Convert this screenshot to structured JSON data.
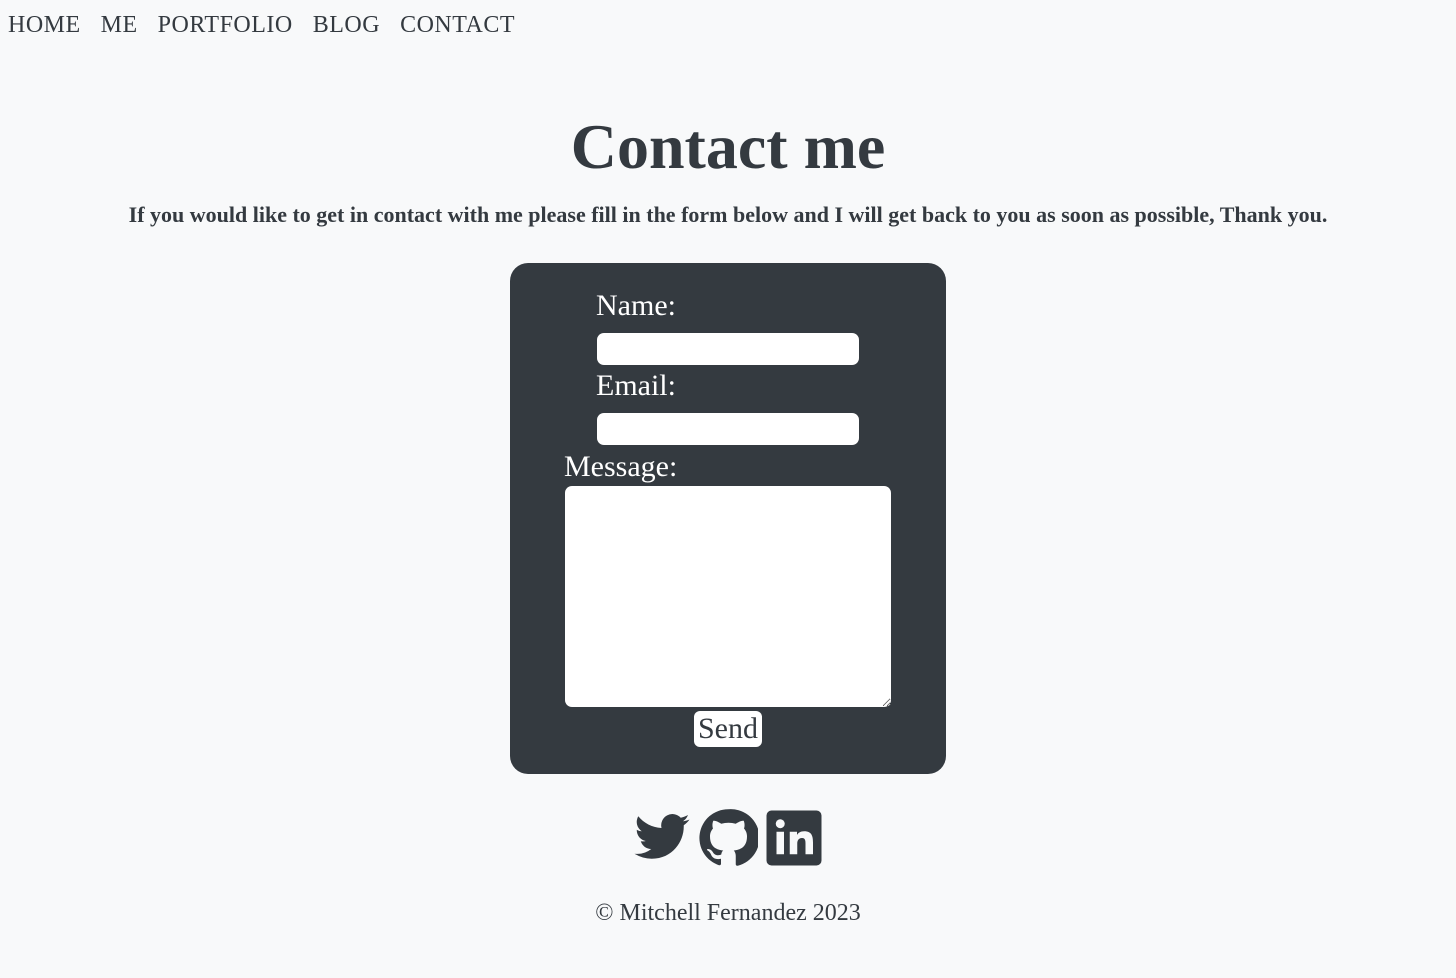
{
  "nav": {
    "items": [
      {
        "label": "HOME"
      },
      {
        "label": "ME"
      },
      {
        "label": "PORTFOLIO"
      },
      {
        "label": "BLOG"
      },
      {
        "label": "CONTACT"
      }
    ]
  },
  "header": {
    "title": "Contact me",
    "intro": "If you would like to get in contact with me please fill in the form below and I will get back to you as soon as possible, Thank you."
  },
  "form": {
    "name_label": "Name:",
    "name_value": "",
    "email_label": "Email:",
    "email_value": "",
    "message_label": "Message:",
    "message_value": "",
    "send_label": "Send"
  },
  "socials": {
    "icons": [
      "twitter-icon",
      "github-icon",
      "linkedin-icon"
    ]
  },
  "footer": {
    "copyright": "© Mitchell Fernandez 2023"
  },
  "colors": {
    "background": "#f8f9fa",
    "text": "#343a40",
    "card": "#343a40",
    "field": "#ffffff"
  }
}
